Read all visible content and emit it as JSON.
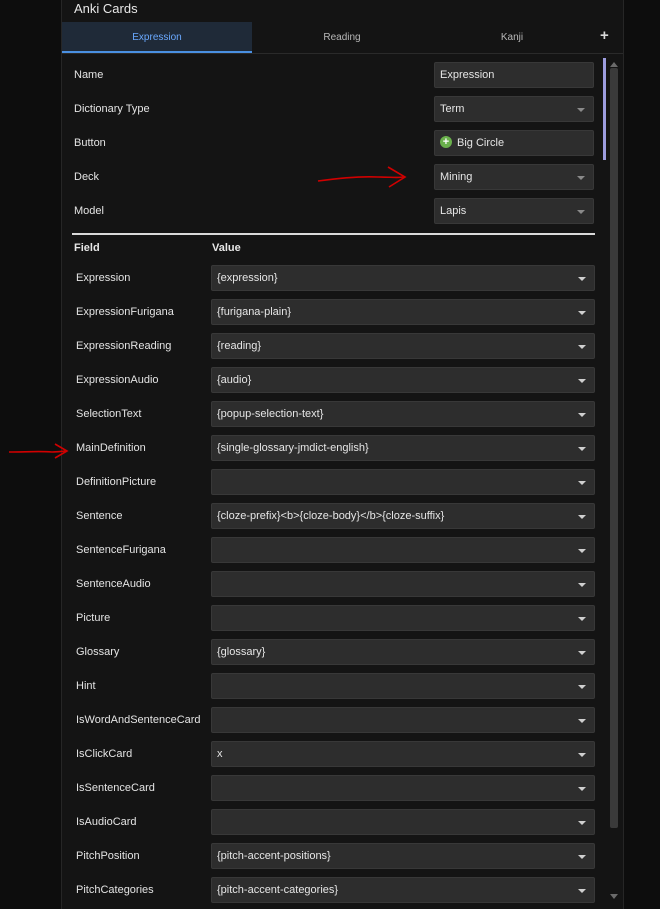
{
  "window": {
    "title": "Anki Cards"
  },
  "tabs": [
    {
      "label": "Expression",
      "active": true
    },
    {
      "label": "Reading",
      "active": false
    },
    {
      "label": "Kanji",
      "active": false
    }
  ],
  "settings": {
    "name": {
      "label": "Name",
      "value": "Expression"
    },
    "dictionary_type": {
      "label": "Dictionary Type",
      "value": "Term"
    },
    "button": {
      "label": "Button",
      "value": "Big Circle"
    },
    "deck": {
      "label": "Deck",
      "value": "Mining"
    },
    "model": {
      "label": "Model",
      "value": "Lapis"
    }
  },
  "fields_header": {
    "field": "Field",
    "value": "Value"
  },
  "fields": [
    {
      "name": "Expression",
      "value": "{expression}"
    },
    {
      "name": "ExpressionFurigana",
      "value": "{furigana-plain}"
    },
    {
      "name": "ExpressionReading",
      "value": "{reading}"
    },
    {
      "name": "ExpressionAudio",
      "value": "{audio}"
    },
    {
      "name": "SelectionText",
      "value": "{popup-selection-text}"
    },
    {
      "name": "MainDefinition",
      "value": "{single-glossary-jmdict-english}"
    },
    {
      "name": "DefinitionPicture",
      "value": ""
    },
    {
      "name": "Sentence",
      "value": "{cloze-prefix}<b>{cloze-body}</b>{cloze-suffix}"
    },
    {
      "name": "SentenceFurigana",
      "value": ""
    },
    {
      "name": "SentenceAudio",
      "value": ""
    },
    {
      "name": "Picture",
      "value": ""
    },
    {
      "name": "Glossary",
      "value": "{glossary}"
    },
    {
      "name": "Hint",
      "value": ""
    },
    {
      "name": "IsWordAndSentenceCard",
      "value": ""
    },
    {
      "name": "IsClickCard",
      "value": "x"
    },
    {
      "name": "IsSentenceCard",
      "value": ""
    },
    {
      "name": "IsAudioCard",
      "value": ""
    },
    {
      "name": "PitchPosition",
      "value": "{pitch-accent-positions}"
    },
    {
      "name": "PitchCategories",
      "value": "{pitch-accent-categories}"
    }
  ],
  "icons": {
    "add_tab": "plus-icon",
    "button_icon": "green-plus-circle-icon",
    "dropdown": "chevron-down-icon",
    "annotation": "red-arrow-icon"
  },
  "colors": {
    "accent": "#4a90e2",
    "annotation": "#d10000",
    "button_icon": "#6ab04c"
  }
}
